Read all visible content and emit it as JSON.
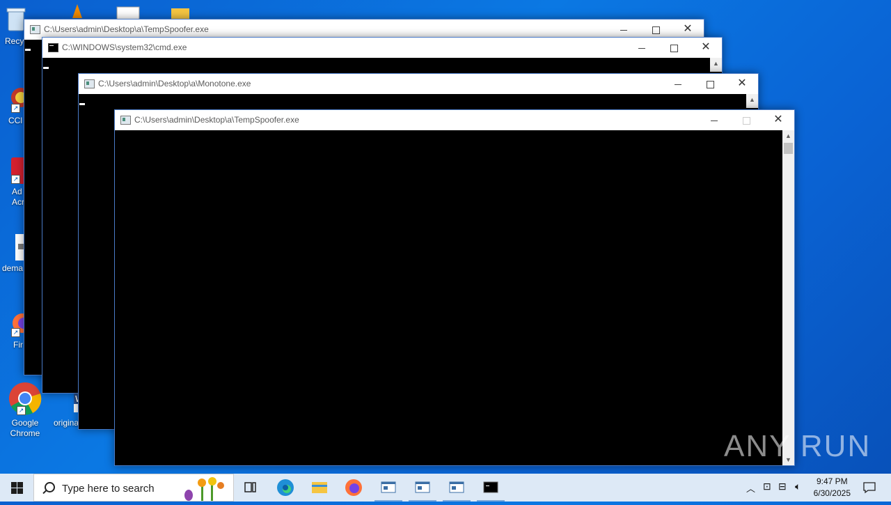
{
  "desktop": {
    "icons": [
      {
        "label": "Recy",
        "icon": "recycle-bin-icon"
      },
      {
        "label": "CCl",
        "icon": "ccleaner-icon"
      },
      {
        "label": "Ad\nAcr",
        "icon": "adobe-acrobat-icon"
      },
      {
        "label": "dema",
        "icon": "document-icon"
      },
      {
        "label": "Fir",
        "icon": "firefox-icon"
      },
      {
        "label": "Google\nChrome",
        "icon": "chrome-icon"
      },
      {
        "label": "origina",
        "icon": "word-document-icon"
      }
    ]
  },
  "windows": [
    {
      "title": "C:\\Users\\admin\\Desktop\\a\\TempSpoofer.exe",
      "icon": "console-app-icon"
    },
    {
      "title": "C:\\WINDOWS\\system32\\cmd.exe",
      "icon": "cmd-icon"
    },
    {
      "title": "C:\\Users\\admin\\Desktop\\a\\Monotone.exe",
      "icon": "console-app-icon"
    },
    {
      "title": "C:\\Users\\admin\\Desktop\\a\\TempSpoofer.exe",
      "icon": "console-app-icon"
    }
  ],
  "window_controls": {
    "minimize": "—",
    "maximize": "☐",
    "close": "✕"
  },
  "taskbar": {
    "search_placeholder": "Type here to search",
    "pinned": [
      "task-view-icon",
      "edge-icon",
      "file-explorer-icon",
      "firefox-icon"
    ],
    "running": [
      "console-window-icon",
      "console-window-icon",
      "console-window-icon",
      "cmd-icon"
    ]
  },
  "clock": {
    "time": "9:47 PM",
    "date": "6/30/2025"
  },
  "watermark": "ANY RUN"
}
